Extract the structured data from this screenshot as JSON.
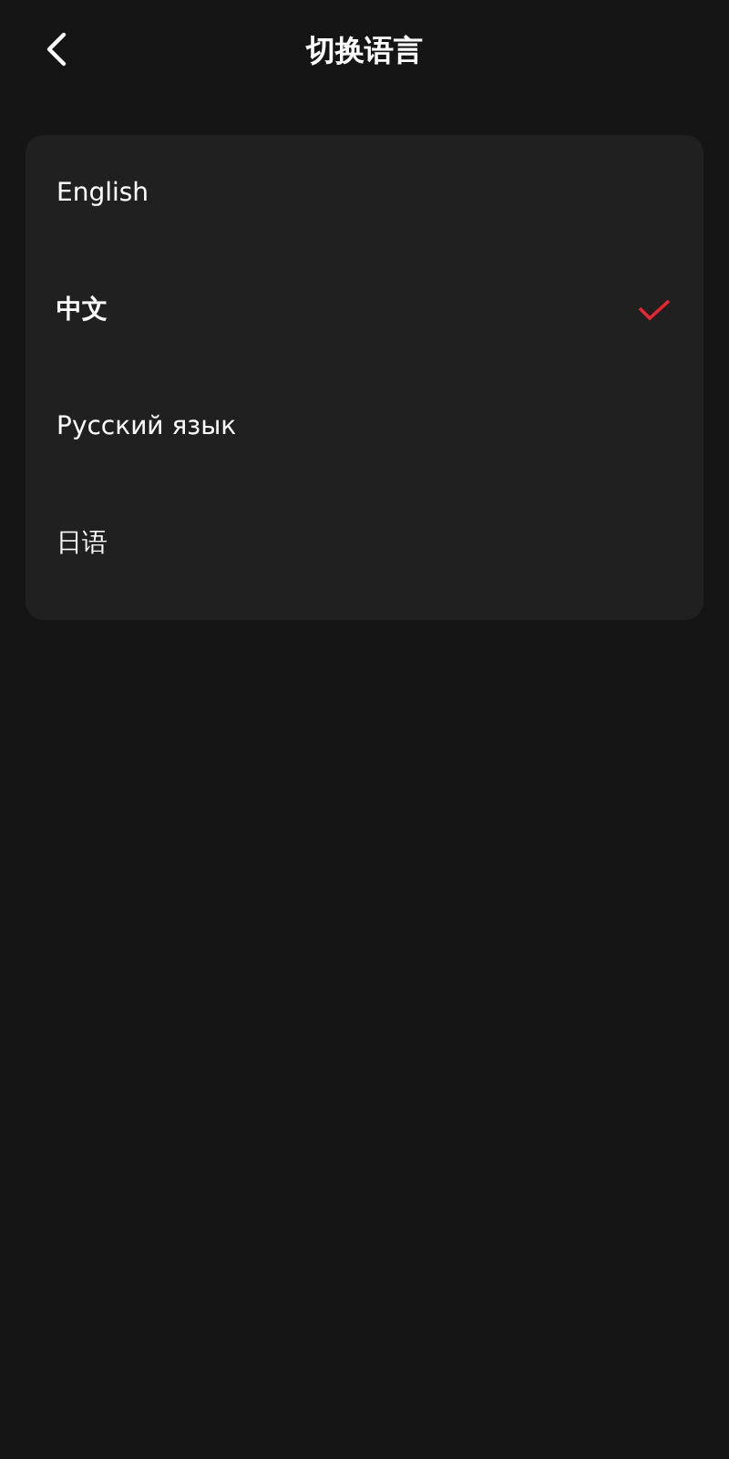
{
  "header": {
    "title": "切换语言"
  },
  "languages": [
    {
      "label": "English",
      "selected": false
    },
    {
      "label": "中文",
      "selected": true
    },
    {
      "label": "Русский язык",
      "selected": false
    },
    {
      "label": "日语",
      "selected": false
    }
  ]
}
